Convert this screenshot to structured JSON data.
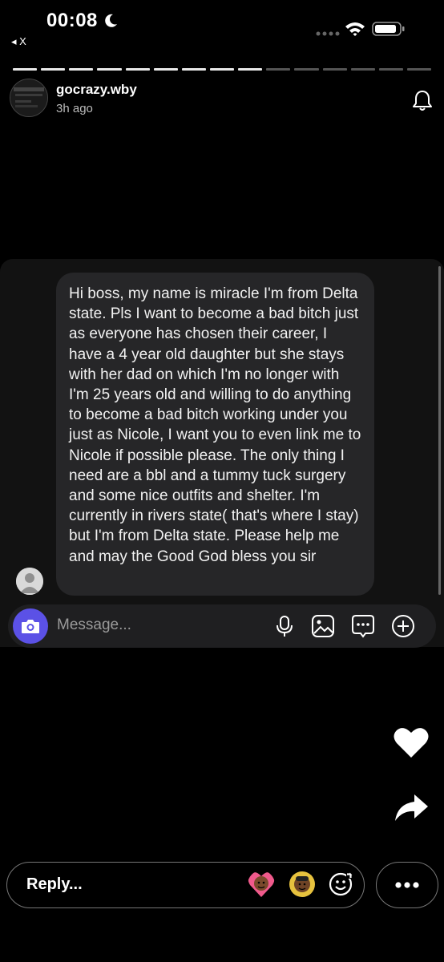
{
  "status_bar": {
    "time": "00:08"
  },
  "nav": {
    "back_label": "◂ X"
  },
  "story": {
    "segments_total": 15,
    "segments_viewed": 9
  },
  "header": {
    "username": "gocrazy.wby",
    "time_ago": "3h ago"
  },
  "chat": {
    "message": "Hi boss, my name is miracle I'm from Delta state. Pls I want to become a bad bitch just as everyone has chosen their career, I have a 4 year old daughter but she stays with her dad on which I'm no longer with I'm 25 years old and willing to do anything to become a bad bitch working under you just as Nicole, I want you to even link me to Nicole if possible please. The only thing I need are a bbl and a tummy tuck surgery and some nice outfits and shelter. I'm currently in rivers state( that's where I stay) but I'm from Delta state. Please help me and may the Good God bless you sir",
    "input_placeholder": "Message..."
  },
  "reply": {
    "placeholder": "Reply..."
  },
  "icons": {
    "camera": "camera-icon",
    "mic": "microphone-icon",
    "gallery": "gallery-icon",
    "sticker": "sticker-icon",
    "add": "plus-icon",
    "heart": "heart-icon",
    "share": "share-icon",
    "more": "more-icon",
    "bell": "bell-icon"
  },
  "colors": {
    "accent": "#5b51e6",
    "background": "#000000",
    "bubble": "#262628"
  }
}
